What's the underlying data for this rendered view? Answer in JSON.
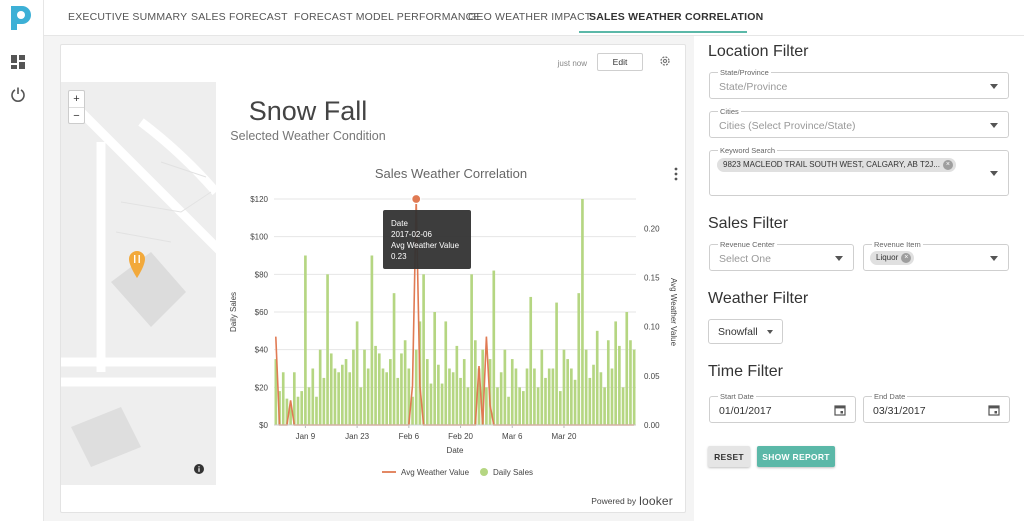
{
  "nav": {
    "tabs": [
      {
        "label": "EXECUTIVE SUMMARY"
      },
      {
        "label": "SALES FORECAST"
      },
      {
        "label": "FORECAST MODEL PERFORMANCE"
      },
      {
        "label": "GEO WEATHER IMPACT"
      },
      {
        "label": "SALES WEATHER CORRELATION"
      }
    ],
    "active_tab": "SALES WEATHER CORRELATION"
  },
  "card": {
    "timestamp": "just now",
    "edit_label": "Edit",
    "zoom_in": "+",
    "zoom_out": "−",
    "weather_title": "Snow Fall",
    "weather_subtitle": "Selected Weather Condition",
    "powered_by": "Powered by",
    "brand": "looker"
  },
  "chart_data": {
    "type": "bar",
    "title": "Sales Weather Correlation",
    "xlabel": "Date",
    "ylabel": "Daily Sales",
    "y2label": "Avg Weather Value",
    "ylim": [
      0,
      120
    ],
    "y2lim": [
      0,
      0.23
    ],
    "y_ticks": [
      "$0",
      "$20",
      "$40",
      "$60",
      "$80",
      "$100",
      "$120"
    ],
    "y2_ticks": [
      "0.00",
      "0.05",
      "0.10",
      "0.15",
      "0.20"
    ],
    "x_ticks": [
      "Jan 9",
      "Jan 23",
      "Feb 6",
      "Feb 20",
      "Mar 6",
      "Mar 20"
    ],
    "legend": [
      "Avg Weather Value",
      "Daily Sales"
    ],
    "legend_position": "bottom",
    "colors": {
      "bars": "#b5d682",
      "line": "#e07a53"
    },
    "daily_sales": [
      35,
      18,
      28,
      14,
      10,
      28,
      15,
      18,
      90,
      20,
      30,
      15,
      40,
      25,
      80,
      38,
      30,
      28,
      32,
      35,
      28,
      40,
      55,
      20,
      40,
      30,
      90,
      42,
      38,
      30,
      28,
      35,
      70,
      25,
      38,
      45,
      30,
      15,
      40,
      55,
      80,
      35,
      22,
      60,
      32,
      22,
      55,
      30,
      28,
      42,
      25,
      35,
      20,
      80,
      45,
      30,
      40,
      20,
      35,
      82,
      20,
      28,
      40,
      15,
      35,
      30,
      20,
      18,
      30,
      68,
      30,
      20,
      40,
      25,
      30,
      30,
      65,
      18,
      40,
      35,
      30,
      24,
      70,
      120,
      40,
      25,
      32,
      50,
      28,
      20,
      45,
      30,
      55,
      42,
      20,
      60,
      45,
      40
    ],
    "weather_values": [
      0.09,
      0.0,
      0.0,
      0.0,
      0.025,
      0.0,
      0.0,
      0.0,
      0.0,
      0.0,
      0.0,
      0.0,
      0.0,
      0.0,
      0.0,
      0.0,
      0.0,
      0.0,
      0.0,
      0.0,
      0.0,
      0.0,
      0.0,
      0.0,
      0.0,
      0.0,
      0.0,
      0.0,
      0.0,
      0.0,
      0.0,
      0.0,
      0.0,
      0.0,
      0.0,
      0.0,
      0.0,
      0.0,
      0.0,
      0.0,
      0.0,
      0.0,
      0.0,
      0.0,
      0.0,
      0.0,
      0.0,
      0.0,
      0.0,
      0.0,
      0.0,
      0.0,
      0.0,
      0.0,
      0.0,
      0.0,
      0.0,
      0.0,
      0.0,
      0.0,
      0.0,
      0.0,
      0.0,
      0.0,
      0.0,
      0.0,
      0.0,
      0.0,
      0.0,
      0.0,
      0.0,
      0.0,
      0.0,
      0.0,
      0.0,
      0.0,
      0.0,
      0.0,
      0.0,
      0.0,
      0.0,
      0.0,
      0.0,
      0.0,
      0.0,
      0.0,
      0.0,
      0.0,
      0.0,
      0.0,
      0.0,
      0.0,
      0.0,
      0.0,
      0.0,
      0.0,
      0.0,
      0.0
    ],
    "tooltip": {
      "date_label": "Date",
      "date": "2017-02-06",
      "metric_label": "Avg Weather Value",
      "value": "0.23"
    }
  },
  "filters": {
    "location_heading": "Location Filter",
    "state_label": "State/Province",
    "state_placeholder": "State/Province",
    "cities_label": "Cities",
    "cities_placeholder": "Cities (Select Province/State)",
    "keyword_label": "Keyword Search",
    "keyword_chip": "9823 MACLEOD TRAIL SOUTH WEST, CALGARY, AB T2J...",
    "sales_heading": "Sales Filter",
    "revenue_center_label": "Revenue Center",
    "revenue_center_placeholder": "Select One",
    "revenue_item_label": "Revenue Item",
    "revenue_item_chip": "Liquor",
    "weather_heading": "Weather Filter",
    "weather_value": "Snowfall",
    "time_heading": "Time Filter",
    "start_label": "Start Date",
    "start_value": "01/01/2017",
    "end_label": "End Date",
    "end_value": "03/31/2017",
    "reset_label": "RESET",
    "show_label": "SHOW REPORT"
  }
}
